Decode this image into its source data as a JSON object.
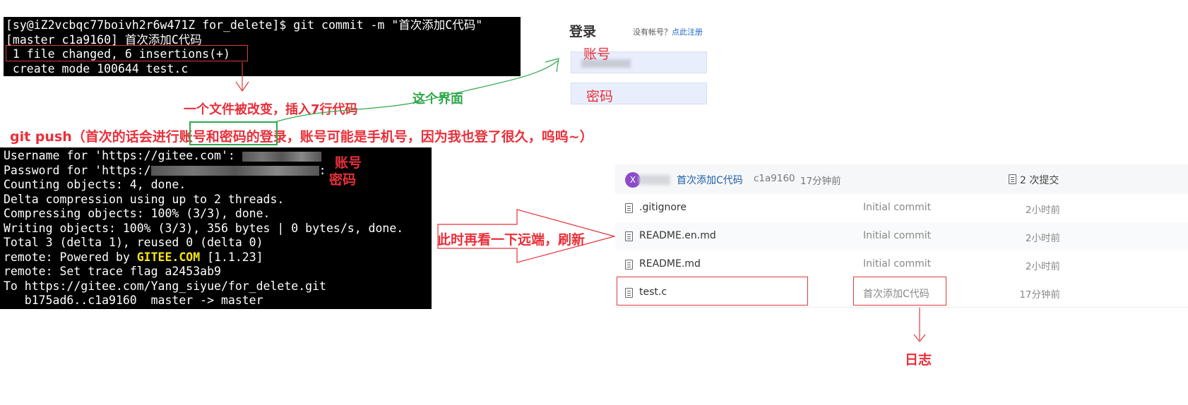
{
  "terminal_commit": {
    "prompt": "[sy@iZ2vcbqc77boivh2r6w471Z for_delete]$ git commit -m \"首次添加C代码\"",
    "output": [
      "[master c1a9160] 首次添加C代码",
      " 1 file changed, 6 insertions(+)",
      " create mode 100644 test.c"
    ]
  },
  "annotations": {
    "file_changed": "一个文件被改变，插入7行代码",
    "this_screen": "这个界面",
    "git_push_note": "git push（首次的话会进行账号和密码的登录，账号可能是手机号，因为我也登了很久，呜呜~）",
    "account": "账号",
    "password": "密码",
    "look_remote": "此时再看一下远端，刷新",
    "log": "日志"
  },
  "terminal_push": {
    "username_prefix": "Username for 'https://gitee.com':",
    "password_prefix": "Password for 'https:/",
    "password_suffix": ":",
    "lines": [
      "Counting objects: 4, done.",
      "Delta compression using up to 2 threads.",
      "Compressing objects: 100% (3/3), done.",
      "Writing objects: 100% (3/3), 356 bytes | 0 bytes/s, done.",
      "Total 3 (delta 1), reused 0 (delta 0)"
    ],
    "powered_prefix": "remote: Powered by ",
    "powered_brand": "GITEE.COM",
    "powered_suffix": " [1.1.23]",
    "tail": [
      "remote: Set trace flag a2453ab9",
      "To https://gitee.com/Yang_siyue/for_delete.git",
      "   b175ad6..c1a9160  master -> master"
    ]
  },
  "login": {
    "title": "登录",
    "hint": "没有帐号？",
    "hint_link": "点此注册",
    "account_label": "账号",
    "password_label": "密码"
  },
  "repo": {
    "avatar_letter": "X",
    "latest_commit": {
      "message": "首次添加C代码",
      "hash": "c1a9160",
      "time": "17分钟前"
    },
    "commit_count": "2 次提交",
    "files": [
      {
        "name": ".gitignore",
        "commit": "Initial commit",
        "time": "2小时前"
      },
      {
        "name": "README.en.md",
        "commit": "Initial commit",
        "time": "2小时前"
      },
      {
        "name": "README.md",
        "commit": "Initial commit",
        "time": "2小时前"
      },
      {
        "name": "test.c",
        "commit": "首次添加C代码",
        "time": "17分钟前"
      }
    ]
  },
  "colors": {
    "annotation_red": "#e8303a",
    "annotation_green": "#2fa84a",
    "gitee_yellow": "#f5e31a",
    "link_blue": "#1e5ea8"
  }
}
